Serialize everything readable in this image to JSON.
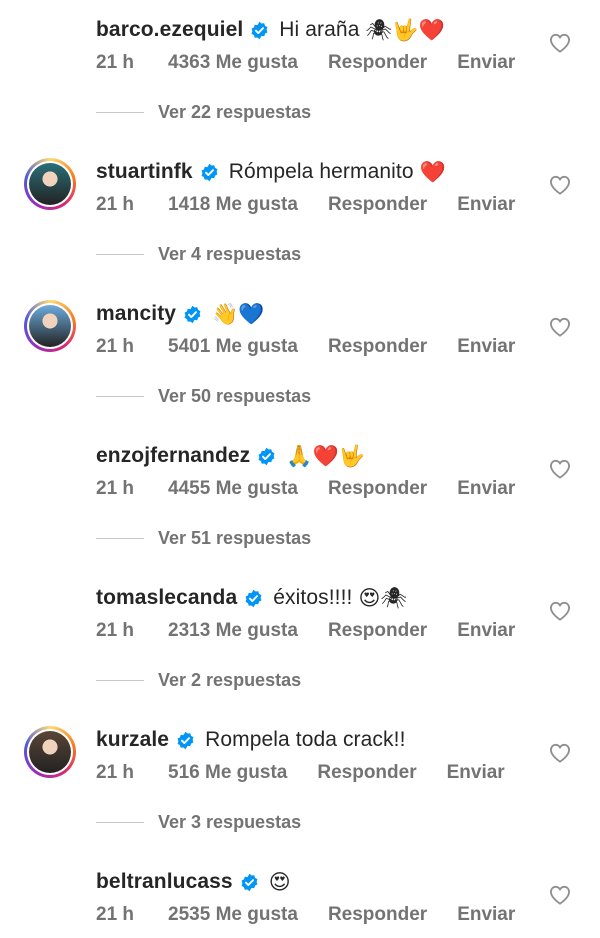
{
  "comments": [
    {
      "username": "barco.ezequiel",
      "text": "Hi araña",
      "emoji": "🕷🤟❤️",
      "time": "21 h",
      "likes": "4363 Me gusta",
      "reply": "Responder",
      "send": "Enviar",
      "replies": "Ver 22 respuestas",
      "avatar_color": "#b5392c",
      "ring": false
    },
    {
      "username": "stuartinfk",
      "text": "Rómpela hermanito",
      "emoji": "❤️",
      "time": "21 h",
      "likes": "1418 Me gusta",
      "reply": "Responder",
      "send": "Enviar",
      "replies": "Ver 4 respuestas",
      "avatar_color": "#2a6f78",
      "ring": true
    },
    {
      "username": "mancity",
      "text": "",
      "emoji": "👋💙",
      "time": "21 h",
      "likes": "5401 Me gusta",
      "reply": "Responder",
      "send": "Enviar",
      "replies": "Ver 50 respuestas",
      "avatar_color": "#6cabdd",
      "ring": true
    },
    {
      "username": "enzojfernandez",
      "text": "",
      "emoji": "🙏❤️🤟",
      "time": "21 h",
      "likes": "4455 Me gusta",
      "reply": "Responder",
      "send": "Enviar",
      "replies": "Ver 51 respuestas",
      "avatar_color": "#3a3a3a",
      "ring": false
    },
    {
      "username": "tomaslecanda",
      "text": "éxitos!!!!",
      "emoji": "😍🕷",
      "time": "21 h",
      "likes": "2313 Me gusta",
      "reply": "Responder",
      "send": "Enviar",
      "replies": "Ver 2 respuestas",
      "avatar_color": "#4c8a3c",
      "ring": false
    },
    {
      "username": "kurzale",
      "text": "Rompela toda crack!!",
      "emoji": "",
      "time": "21 h",
      "likes": "516 Me gusta",
      "reply": "Responder",
      "send": "Enviar",
      "replies": "Ver 3 respuestas",
      "avatar_color": "#5a4636",
      "ring": true
    },
    {
      "username": "beltranlucass",
      "text": "",
      "emoji": "😍",
      "time": "21 h",
      "likes": "2535 Me gusta",
      "reply": "Responder",
      "send": "Enviar",
      "replies": "",
      "avatar_color": "#8a3f3a",
      "ring": false
    }
  ],
  "colors": {
    "verified": "#0095f6",
    "secondary": "#737373",
    "primary": "#262626"
  },
  "icons": {
    "verified": "verified-badge-icon",
    "like": "heart-outline-icon"
  }
}
